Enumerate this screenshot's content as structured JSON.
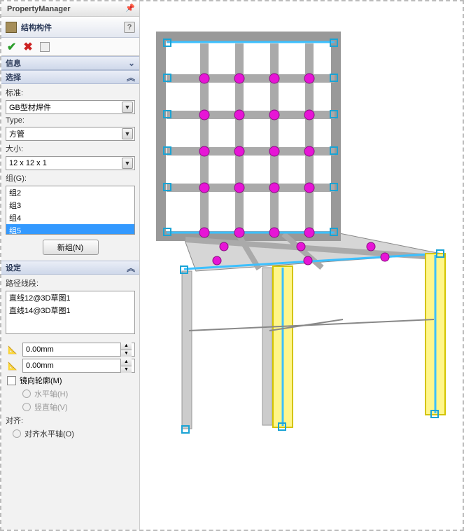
{
  "pm": {
    "title": "PropertyManager"
  },
  "feature": {
    "title": "结构构件",
    "help": "?"
  },
  "sections": {
    "info": {
      "title": "信息"
    },
    "select": {
      "title": "选择"
    },
    "settings": {
      "title": "设定"
    }
  },
  "select": {
    "std_label": "标准:",
    "std_value": "GB型材焊件",
    "type_label": "Type:",
    "type_value": "方管",
    "size_label": "大小:",
    "size_value": "12 x 12 x 1",
    "group_label": "组(G):",
    "groups": [
      "组2",
      "组3",
      "组4",
      "组5"
    ],
    "selected_group_index": 3,
    "new_group_btn": "新组(N)"
  },
  "settings": {
    "path_label": "路径线段:",
    "paths": [
      "直线12@3D草图1",
      "直线14@3D草图1"
    ],
    "offset1": "0.00mm",
    "offset2": "0.00mm",
    "mirror_label": "镜向轮廓(M)",
    "hor_axis": "水平轴(H)",
    "ver_axis": "竖直轴(V)",
    "align_label": "对齐:",
    "align_hor": "对齐水平轴(O)"
  }
}
